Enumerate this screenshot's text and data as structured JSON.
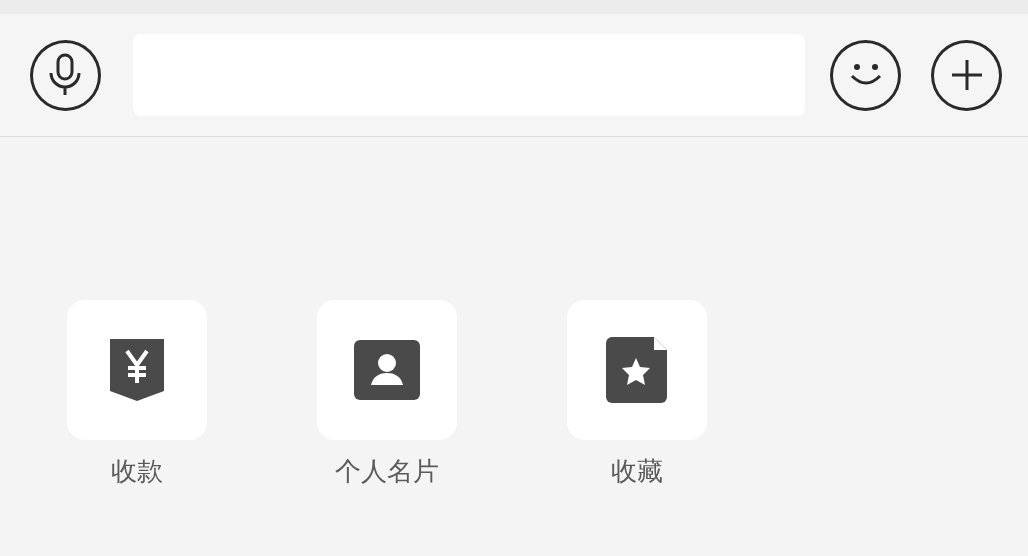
{
  "panel_items": [
    {
      "label": "收款",
      "kind": "payment"
    },
    {
      "label": "个人名片",
      "kind": "contact"
    },
    {
      "label": "收藏",
      "kind": "favorite"
    }
  ]
}
